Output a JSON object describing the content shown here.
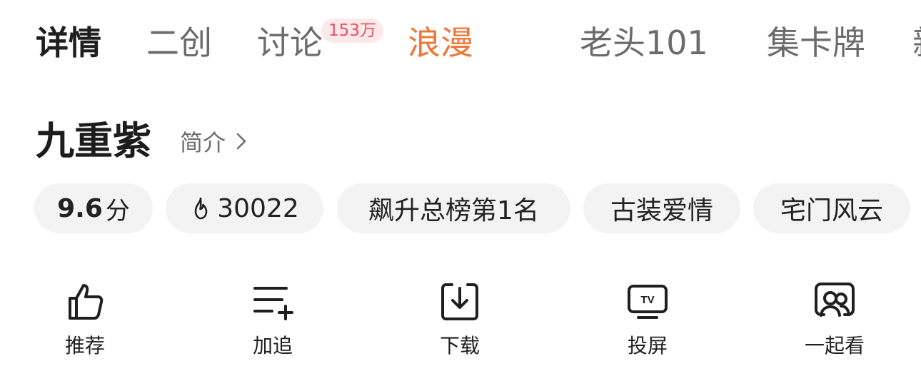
{
  "tabs": [
    {
      "label": "详情"
    },
    {
      "label": "二创"
    },
    {
      "label": "讨论",
      "badge": "153万"
    },
    {
      "label": "浪漫"
    },
    {
      "label": "老头101"
    },
    {
      "label": "集卡牌"
    },
    {
      "label": "新"
    }
  ],
  "show": {
    "title": "九重紫",
    "intro_label": "简介"
  },
  "chips": {
    "score_value": "9.6",
    "score_unit": "分",
    "heat_value": "30022",
    "rank": "飙升总榜第1名",
    "genre_1": "古装爱情",
    "genre_2": "宅门风云"
  },
  "actions": [
    {
      "label": "推荐",
      "icon": "thumbs-up-icon"
    },
    {
      "label": "加追",
      "icon": "add-to-list-icon"
    },
    {
      "label": "下载",
      "icon": "download-icon"
    },
    {
      "label": "投屏",
      "icon": "tv-cast-icon"
    },
    {
      "label": "一起看",
      "icon": "watch-together-icon"
    }
  ],
  "colors": {
    "accent_tab": "#f07536",
    "badge_bg": "#fde8ea",
    "badge_text": "#ee4f5f",
    "chip_bg": "#f3f3f3"
  }
}
